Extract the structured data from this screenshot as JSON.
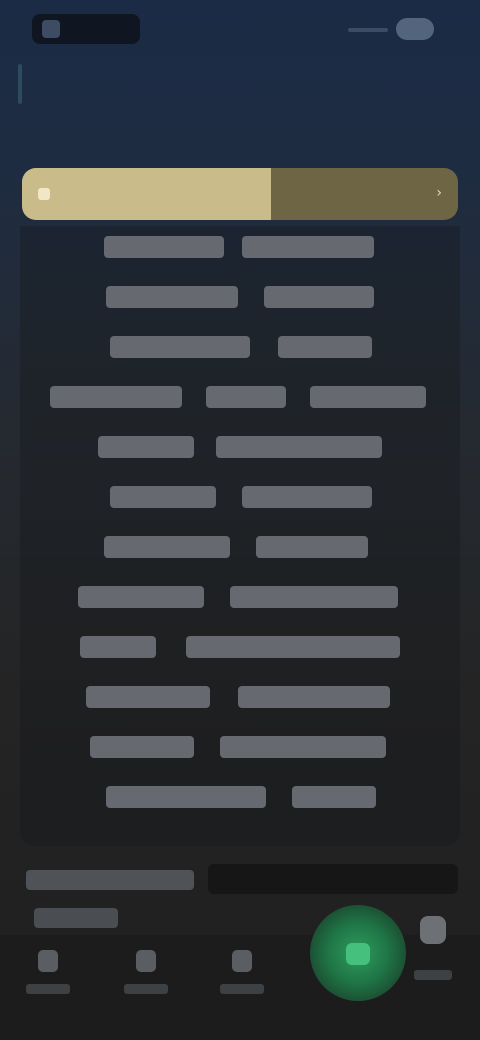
{
  "header": {
    "title": ""
  },
  "selector": {
    "label": "",
    "fill_fraction": 0.57
  },
  "list": {
    "rows": [
      [
        "",
        ""
      ],
      [
        "",
        ""
      ],
      [
        "",
        ""
      ],
      [
        "",
        "",
        ""
      ],
      [
        "",
        ""
      ],
      [
        "",
        ""
      ],
      [
        "",
        ""
      ],
      [
        "",
        ""
      ],
      [
        "",
        ""
      ],
      [
        "",
        ""
      ],
      [
        "",
        ""
      ],
      [
        "",
        ""
      ]
    ]
  },
  "summary": {
    "title": "",
    "subtitle": ""
  },
  "nav": {
    "items": [
      {
        "icon": "home-icon",
        "label": ""
      },
      {
        "icon": "list-icon",
        "label": ""
      },
      {
        "icon": "document-icon",
        "label": ""
      },
      {
        "icon": "plus-icon",
        "label": ""
      },
      {
        "icon": "profile-icon",
        "label": ""
      }
    ]
  },
  "colors": {
    "accent_gold": "#c9bc8a",
    "accent_green": "#2e9c5c",
    "header_blue": "#1b2b45"
  }
}
